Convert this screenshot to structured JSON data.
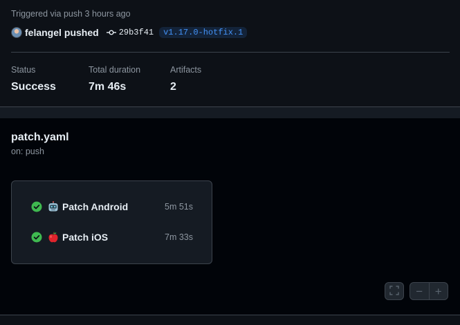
{
  "summary": {
    "triggered_text": "Triggered via push 3 hours ago",
    "actor": "felangel",
    "action": "pushed",
    "commit_sha": "29b3f41",
    "branch": "v1.17.0-hotfix.1",
    "stats": {
      "status": {
        "label": "Status",
        "value": "Success"
      },
      "duration": {
        "label": "Total duration",
        "value": "7m 46s"
      },
      "artifacts": {
        "label": "Artifacts",
        "value": "2"
      }
    }
  },
  "workflow": {
    "file_name": "patch.yaml",
    "trigger": "on: push",
    "jobs": [
      {
        "name": "Patch Android",
        "duration": "5m 51s",
        "emoji": "robot-face-icon",
        "status": "success"
      },
      {
        "name": "Patch iOS",
        "duration": "7m 33s",
        "emoji": "red-apple-icon",
        "status": "success"
      }
    ]
  },
  "graph_controls": {
    "fullscreen_icon": "fullscreen-icon",
    "zoom_out_label": "−",
    "zoom_in_label": "+"
  },
  "colors": {
    "success": "#3fb950",
    "link": "#4493f8",
    "muted": "#8d96a0"
  }
}
